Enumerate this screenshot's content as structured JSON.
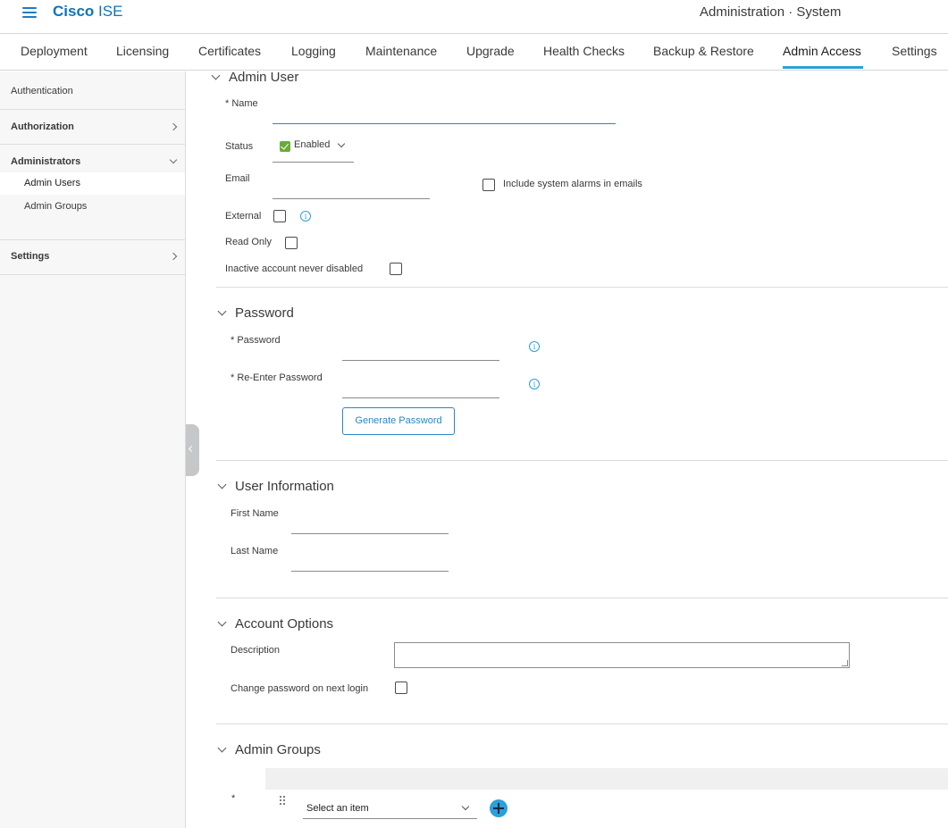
{
  "header": {
    "brand_bold": "Cisco",
    "brand_light": " ISE",
    "page_heading": "Administration · System"
  },
  "tabs": [
    {
      "label": "Deployment"
    },
    {
      "label": "Licensing"
    },
    {
      "label": "Certificates"
    },
    {
      "label": "Logging"
    },
    {
      "label": "Maintenance"
    },
    {
      "label": "Upgrade"
    },
    {
      "label": "Health Checks"
    },
    {
      "label": "Backup & Restore"
    },
    {
      "label": "Admin Access"
    },
    {
      "label": "Settings"
    }
  ],
  "active_tab": "Admin Access",
  "sidebar": {
    "authentication": "Authentication",
    "authorization": "Authorization",
    "administrators": "Administrators",
    "admin_users": "Admin Users",
    "admin_groups": "Admin Groups",
    "settings": "Settings"
  },
  "admin_user": {
    "title": "Admin User",
    "name_label": "* Name",
    "name_value": "",
    "status_label": "Status",
    "status_value": "Enabled",
    "email_label": "Email",
    "include_alarms_label": "Include system alarms in emails",
    "external_label": "External",
    "read_only_label": "Read Only",
    "inactive_label": "Inactive account never disabled"
  },
  "password": {
    "title": "Password",
    "password_label": "* Password",
    "reenter_label": "* Re-Enter Password",
    "generate_button": "Generate Password"
  },
  "user_info": {
    "title": "User Information",
    "first_name_label": "First Name",
    "last_name_label": "Last Name"
  },
  "account_options": {
    "title": "Account Options",
    "description_label": "Description",
    "change_password_label": "Change password on next login"
  },
  "admin_groups": {
    "title": "Admin Groups",
    "required_marker": "*",
    "select_placeholder": "Select an item"
  },
  "colors": {
    "brand": "#0d74b9",
    "accent": "#2d9fd9",
    "enabled_green": "#6aab37"
  },
  "icons": [
    "hamburger-icon",
    "chevron-right-icon",
    "chevron-down-icon",
    "info-icon",
    "drag-handle-icon",
    "plus-icon"
  ]
}
